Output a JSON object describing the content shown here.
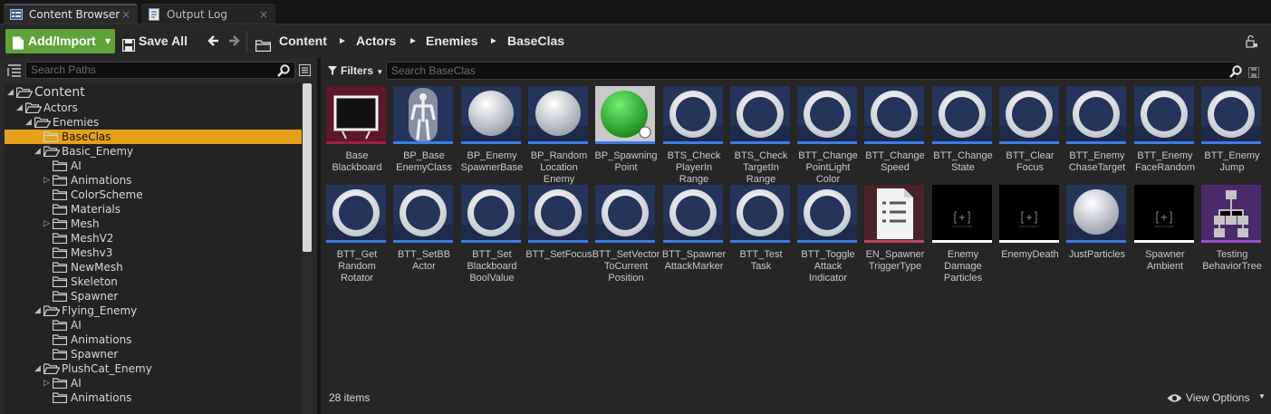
{
  "tabs": [
    {
      "label": "Content Browser",
      "close": "×",
      "icon": "content-browser-icon"
    },
    {
      "label": "Output Log",
      "close": "×",
      "icon": "output-log-icon"
    }
  ],
  "toolbar": {
    "add_import_label": "Add/Import",
    "save_all_label": "Save All",
    "breadcrumbs": [
      "Content",
      "Actors",
      "Enemies",
      "BaseClas"
    ],
    "sep": "►"
  },
  "sources": {
    "search_placeholder": "Search Paths",
    "tree": [
      {
        "label": "Content",
        "depth": 0,
        "expanded": true
      },
      {
        "label": "Actors",
        "depth": 1,
        "expanded": true
      },
      {
        "label": "Enemies",
        "depth": 2,
        "expanded": true
      },
      {
        "label": "BaseClas",
        "depth": 3,
        "selected": true
      },
      {
        "label": "Basic_Enemy",
        "depth": 3,
        "expanded": true
      },
      {
        "label": "AI",
        "depth": 4
      },
      {
        "label": "Animations",
        "depth": 4,
        "collapsed": true
      },
      {
        "label": "ColorScheme",
        "depth": 4
      },
      {
        "label": "Materials",
        "depth": 4
      },
      {
        "label": "Mesh",
        "depth": 4,
        "collapsed": true
      },
      {
        "label": "MeshV2",
        "depth": 4
      },
      {
        "label": "Meshv3",
        "depth": 4
      },
      {
        "label": "NewMesh",
        "depth": 4
      },
      {
        "label": "Skeleton",
        "depth": 4
      },
      {
        "label": "Spawner",
        "depth": 4
      },
      {
        "label": "Flying_Enemy",
        "depth": 3,
        "expanded": true
      },
      {
        "label": "AI",
        "depth": 4
      },
      {
        "label": "Animations",
        "depth": 4
      },
      {
        "label": "Spawner",
        "depth": 4
      },
      {
        "label": "PlushCat_Enemy",
        "depth": 3,
        "expanded": true
      },
      {
        "label": "AI",
        "depth": 4,
        "collapsed": true
      },
      {
        "label": "Animations",
        "depth": 4
      }
    ]
  },
  "assets": {
    "filters_label": "Filters",
    "search_placeholder": "Search BaseClas",
    "items": [
      {
        "name": "Base\nBlackboard",
        "icon": "blackboard-icon",
        "bar": "#a01f4a"
      },
      {
        "name": "BP_Base\nEnemyClass",
        "icon": "mannequin-icon",
        "bar": "#3d7be8"
      },
      {
        "name": "BP_Enemy\nSpawnerBase",
        "icon": "sphere-icon",
        "bar": "#3d7be8"
      },
      {
        "name": "BP_Random\nLocation\nEnemy",
        "icon": "sphere-icon",
        "bar": "#3d7be8"
      },
      {
        "name": "BP_Spawning\nPoint",
        "icon": "green-sphere-icon",
        "bar": "#3d7be8"
      },
      {
        "name": "BTS_Check\nPlayerIn\nRange",
        "icon": "ring-icon",
        "bar": "#3d7be8"
      },
      {
        "name": "BTS_Check\nTargetIn\nRange",
        "icon": "ring-icon",
        "bar": "#3d7be8"
      },
      {
        "name": "BTT_Change\nPointLight\nColor",
        "icon": "ring-icon",
        "bar": "#3d7be8"
      },
      {
        "name": "BTT_Change\nSpeed",
        "icon": "ring-icon",
        "bar": "#3d7be8"
      },
      {
        "name": "BTT_Change\nState",
        "icon": "ring-icon",
        "bar": "#3d7be8"
      },
      {
        "name": "BTT_Clear\nFocus",
        "icon": "ring-icon",
        "bar": "#3d7be8"
      },
      {
        "name": "BTT_Enemy\nChaseTarget",
        "icon": "ring-icon",
        "bar": "#3d7be8"
      },
      {
        "name": "BTT_Enemy\nFaceRandom",
        "icon": "ring-icon",
        "bar": "#3d7be8"
      },
      {
        "name": "BTT_Enemy\nJump",
        "icon": "ring-icon",
        "bar": "#3d7be8"
      },
      {
        "name": "BTT_Get\nRandom\nRotator",
        "icon": "ring-icon",
        "bar": "#3d7be8"
      },
      {
        "name": "BTT_SetBB\nActor",
        "icon": "ring-icon",
        "bar": "#3d7be8"
      },
      {
        "name": "BTT_Set\nBlackboard\nBoolValue",
        "icon": "ring-icon",
        "bar": "#3d7be8"
      },
      {
        "name": "BTT_SetFocus",
        "icon": "ring-icon",
        "bar": "#3d7be8"
      },
      {
        "name": "BTT_SetVector\nToCurrent\nPosition",
        "icon": "ring-icon",
        "bar": "#3d7be8"
      },
      {
        "name": "BTT_Spawner\nAttackMarker",
        "icon": "ring-icon",
        "bar": "#3d7be8"
      },
      {
        "name": "BTT_Test\nTask",
        "icon": "ring-icon",
        "bar": "#3d7be8"
      },
      {
        "name": "BTT_Toggle\nAttack\nIndicator",
        "icon": "ring-icon",
        "bar": "#3d7be8"
      },
      {
        "name": "EN_Spawner\nTriggerType",
        "icon": "enum-list-icon",
        "bar": "#b8475e"
      },
      {
        "name": "Enemy\nDamage\nParticles",
        "icon": "particle-system-icon",
        "bar": "#ffffff"
      },
      {
        "name": "EnemyDeath",
        "icon": "particle-system-icon",
        "bar": "#ffffff"
      },
      {
        "name": "JustParticles",
        "icon": "sphere-icon",
        "bar": "#3d7be8"
      },
      {
        "name": "Spawner\nAmbient",
        "icon": "particle-system-icon",
        "bar": "#ffffff"
      },
      {
        "name": "Testing\nBehaviorTree",
        "icon": "behavior-tree-icon",
        "bar": "#9b4fd0"
      }
    ],
    "count_label": "28 items",
    "view_options_label": "View Options"
  },
  "colors": {
    "accent_green": "#5ea33a",
    "selection": "#e5a01a"
  }
}
